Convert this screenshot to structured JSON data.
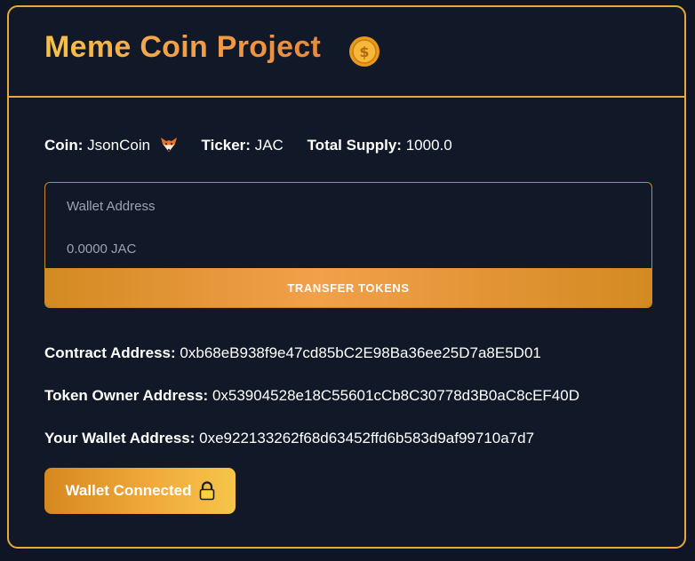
{
  "header": {
    "title": "Meme Coin Project",
    "coin_icon": "gold-coin-dollar-icon"
  },
  "info": {
    "coin_label": "Coin:",
    "coin_value": "JsonCoin",
    "coin_icon": "fox-icon",
    "ticker_label": "Ticker:",
    "ticker_value": "JAC",
    "supply_label": "Total Supply:",
    "supply_value": "1000.0"
  },
  "transfer": {
    "address_placeholder": "Wallet Address",
    "amount_placeholder": "0.0000 JAC",
    "button_label": "TRANSFER TOKENS"
  },
  "addresses": {
    "contract_label": "Contract Address:",
    "contract_value": "0xb68eB938f9e47cd85bC2E98Ba36ee25D7a8E5D01",
    "owner_label": "Token Owner Address:",
    "owner_value": "0x53904528e18C55601cCb8C30778d3B0aC8cEF40D",
    "wallet_label": "Your Wallet Address:",
    "wallet_value": "0xe922133262f68d63452ffd6b583d9af99710a7d7"
  },
  "wallet_button": {
    "label": "Wallet Connected",
    "icon": "lock-icon"
  },
  "colors": {
    "background": "#0f1524",
    "accent": "#e8a93a",
    "title_gradient_start": "#f6c24a",
    "title_gradient_end": "#e88a3a"
  }
}
